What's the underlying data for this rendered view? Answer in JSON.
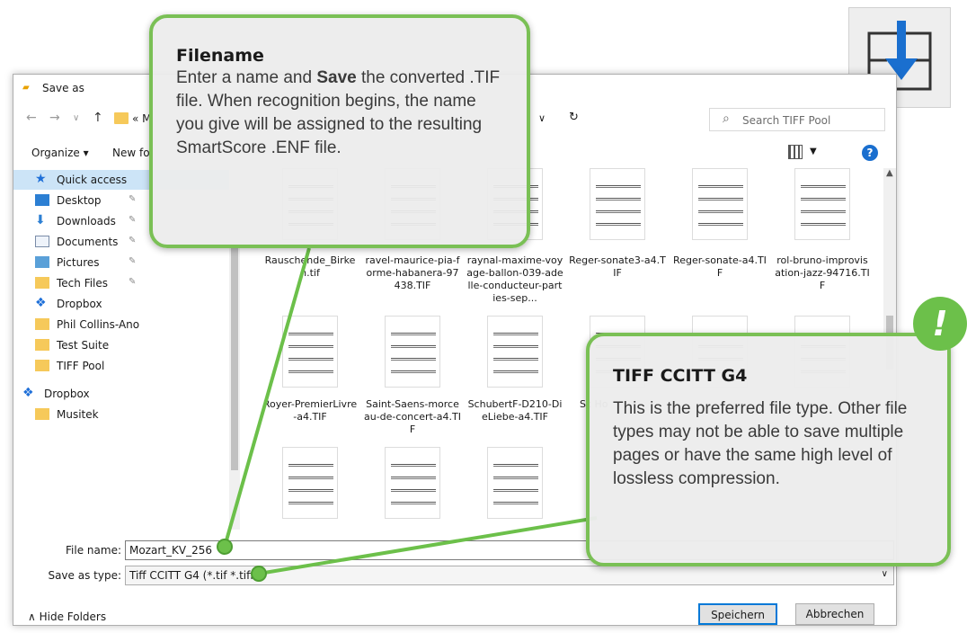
{
  "dialog": {
    "title": "Save as",
    "nav": {
      "back": "←",
      "forward": "→",
      "recent": "∨",
      "up": "↑",
      "breadcrumb": "« M",
      "address_dropdown": "∨",
      "refresh": "↻"
    },
    "search": {
      "placeholder": "Search TIFF Pool",
      "icon": "search-icon"
    },
    "toolbar": {
      "organize": "Organize ▾",
      "new_folder": "New fol",
      "help": "?"
    },
    "sidebar": [
      {
        "label": "Quick access",
        "icon": "star-icon",
        "selected": true
      },
      {
        "label": "Desktop",
        "icon": "desktop-icon",
        "pin": "📌"
      },
      {
        "label": "Downloads",
        "icon": "download-icon",
        "pin": "📌"
      },
      {
        "label": "Documents",
        "icon": "documents-icon",
        "pin": "📌"
      },
      {
        "label": "Pictures",
        "icon": "pictures-icon",
        "pin": "📌"
      },
      {
        "label": "Tech Files",
        "icon": "folder-icon",
        "pin": "📌"
      },
      {
        "label": "Dropbox",
        "icon": "dropbox-icon"
      },
      {
        "label": "Phil Collins-Ano",
        "icon": "folder-icon"
      },
      {
        "label": "Test Suite",
        "icon": "folder-icon"
      },
      {
        "label": "TIFF Pool",
        "icon": "folder-icon"
      },
      {
        "label": "Dropbox",
        "icon": "dropbox-icon"
      },
      {
        "label": "Musitek",
        "icon": "folder-icon"
      }
    ],
    "files": [
      {
        "name": "Rauschende_Birken.tif"
      },
      {
        "name": "ravel-maurice-pia-forme-habanera-97438.TIF"
      },
      {
        "name": "raynal-maxime-voyage-ballon-039-adelle-conducteur-parties-sep..."
      },
      {
        "name": "Reger-sonate3-a4.TIF"
      },
      {
        "name": "Reger-sonate-a4.TIF"
      },
      {
        "name": "rol-bruno-improvisation-jazz-94716.TIF"
      },
      {
        "name": "Royer-PremierLivre-a4.TIF"
      },
      {
        "name": "Saint-Saens-morceau-de-concert-a4.TIF"
      },
      {
        "name": "SchubertF-D210-DieLiebe-a4.TIF"
      },
      {
        "name": "Sc Ho"
      },
      {
        "name": ""
      },
      {
        "name": ""
      },
      {
        "name": ""
      },
      {
        "name": ""
      },
      {
        "name": ""
      }
    ],
    "file_name_label": "File name:",
    "file_name_value": "Mozart_KV_256",
    "save_type_label": "Save as type:",
    "save_type_value": "Tiff CCITT G4 (*.tif *.tiff)",
    "hide_folders": "Hide Folders",
    "save_button": "Speichern",
    "cancel_button": "Abbrechen"
  },
  "callouts": {
    "filename": {
      "title": "Filename",
      "body_pre": "Enter a name and ",
      "body_bold": "Save",
      "body_post": " the converted .TIF file. When recognition begins, the name you give will be assigned to the resulting SmartScore .ENF file."
    },
    "tiff": {
      "title": "TIFF CCITT G4",
      "body": "This is the preferred file type. Other file types may not be able to save multiple pages or have the same high level of lossless compression."
    },
    "alert_symbol": "!"
  },
  "colors": {
    "accent_green": "#6cc04a",
    "icon_blue": "#1e6fd8",
    "save_icon_blue": "#1a6fcf"
  }
}
